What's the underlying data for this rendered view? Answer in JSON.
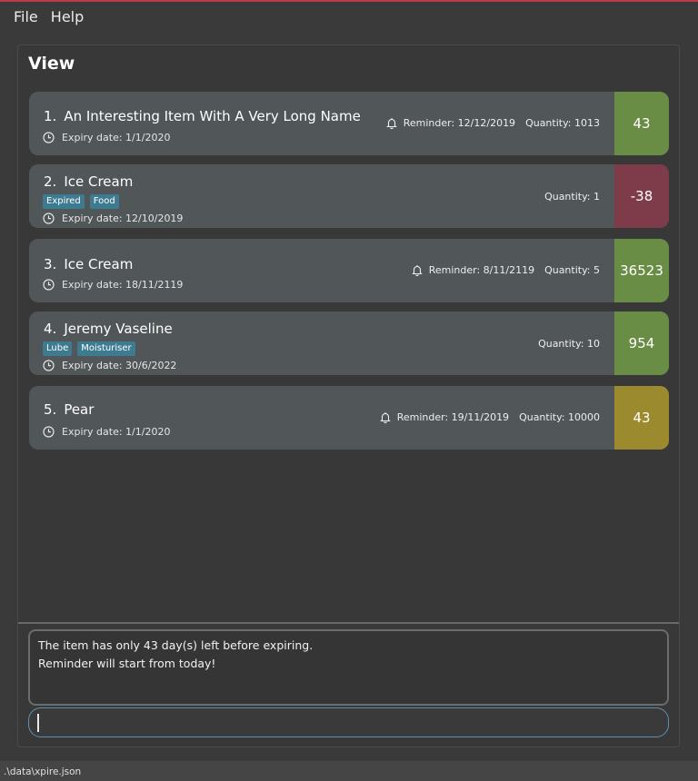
{
  "menu": {
    "file": "File",
    "help": "Help"
  },
  "view": {
    "title": "View"
  },
  "items": [
    {
      "index": "1.",
      "name": "An Interesting Item With A Very Long Name",
      "tags": [],
      "expiry": "Expiry date: 1/1/2020",
      "reminder": "Reminder: 12/12/2019",
      "quantity": "Quantity: 1013",
      "days": "43",
      "status_color": "#6a8d45"
    },
    {
      "index": "2.",
      "name": "Ice Cream",
      "tags": [
        "Expired",
        "Food"
      ],
      "expiry": "Expiry date: 12/10/2019",
      "reminder": "",
      "quantity": "Quantity: 1",
      "days": "-38",
      "status_color": "#7e3c4a"
    },
    {
      "index": "3.",
      "name": "Ice Cream",
      "tags": [],
      "expiry": "Expiry date: 18/11/2119",
      "reminder": "Reminder: 8/11/2119",
      "quantity": "Quantity: 5",
      "days": "36523",
      "status_color": "#6a8d45"
    },
    {
      "index": "4.",
      "name": "Jeremy Vaseline",
      "tags": [
        "Lube",
        "Moisturiser"
      ],
      "expiry": "Expiry date: 30/6/2022",
      "reminder": "",
      "quantity": "Quantity: 10",
      "days": "954",
      "status_color": "#6a8d45"
    },
    {
      "index": "5.",
      "name": "Pear",
      "tags": [],
      "expiry": "Expiry date: 1/1/2020",
      "reminder": "Reminder: 19/11/2019",
      "quantity": "Quantity: 10000",
      "days": "43",
      "status_color": "#9b8b2e"
    }
  ],
  "result": {
    "line1": "The item has only 43 day(s) left before expiring.",
    "line2": "Reminder will start from today!"
  },
  "command": {
    "value": ""
  },
  "status_bar": {
    "path": ".\\data\\xpire.json"
  },
  "colors": {
    "accent": "#c0394b",
    "card_bg": "#515658",
    "tag_bg": "#3e7b91",
    "input_border": "#5f8fb0"
  },
  "icons": {
    "clock": "clock-icon",
    "bell": "bell-icon"
  }
}
